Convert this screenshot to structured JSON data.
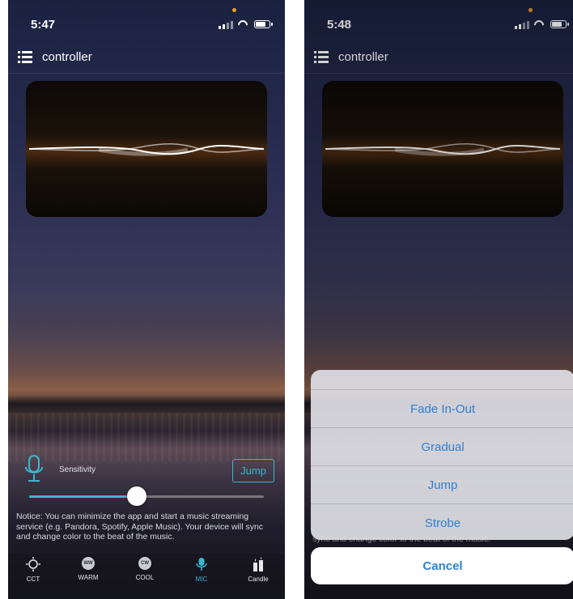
{
  "left_screen": {
    "status_time": "5:47",
    "nav_title": "controller",
    "sensitivity_label": "Sensitivity",
    "mode_button": "Jump",
    "sensitivity_level": 0.46,
    "notice": "Notice: You can minimize the app and start a music streaming service (e.g. Pandora, Spotify, Apple Music). Your device will sync and change color to the beat of the music.",
    "tabs": [
      {
        "label": "CCT",
        "icon": "sun-outline-icon",
        "badge": ""
      },
      {
        "label": "WARM",
        "icon": "ww-badge-icon",
        "badge": "WW"
      },
      {
        "label": "COOL",
        "icon": "cw-badge-icon",
        "badge": "CW"
      },
      {
        "label": "MIC",
        "icon": "microphone-icon",
        "badge": ""
      },
      {
        "label": "Candle",
        "icon": "candle-icon",
        "badge": ""
      }
    ],
    "active_tab": "MIC"
  },
  "right_screen": {
    "status_time": "5:48",
    "nav_title": "controller",
    "sheet_options": [
      "Fade In-Out",
      "Gradual",
      "Jump",
      "Strobe"
    ],
    "cancel_label": "Cancel",
    "obscured_text": "sync and change color to the beat of the music."
  },
  "colors": {
    "accent": "#3ab7d0",
    "sheet_link": "#2d7fd3",
    "status_dot": "#f09a2a"
  }
}
